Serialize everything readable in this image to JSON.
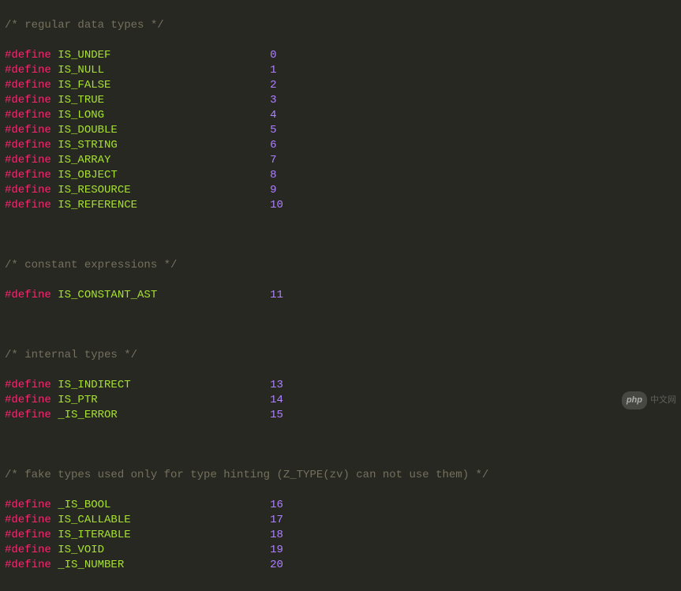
{
  "comment1": "/* regular data types */",
  "defines1": [
    {
      "keyword": "#define",
      "name": "IS_UNDEF",
      "value": "0"
    },
    {
      "keyword": "#define",
      "name": "IS_NULL",
      "value": "1"
    },
    {
      "keyword": "#define",
      "name": "IS_FALSE",
      "value": "2"
    },
    {
      "keyword": "#define",
      "name": "IS_TRUE",
      "value": "3"
    },
    {
      "keyword": "#define",
      "name": "IS_LONG",
      "value": "4"
    },
    {
      "keyword": "#define",
      "name": "IS_DOUBLE",
      "value": "5"
    },
    {
      "keyword": "#define",
      "name": "IS_STRING",
      "value": "6"
    },
    {
      "keyword": "#define",
      "name": "IS_ARRAY",
      "value": "7"
    },
    {
      "keyword": "#define",
      "name": "IS_OBJECT",
      "value": "8"
    },
    {
      "keyword": "#define",
      "name": "IS_RESOURCE",
      "value": "9"
    },
    {
      "keyword": "#define",
      "name": "IS_REFERENCE",
      "value": "10"
    }
  ],
  "comment2": "/* constant expressions */",
  "defines2": [
    {
      "keyword": "#define",
      "name": "IS_CONSTANT_AST",
      "value": "11"
    }
  ],
  "comment3": "/* internal types */",
  "defines3": [
    {
      "keyword": "#define",
      "name": "IS_INDIRECT",
      "value": "13"
    },
    {
      "keyword": "#define",
      "name": "IS_PTR",
      "value": "14"
    },
    {
      "keyword": "#define",
      "name": "_IS_ERROR",
      "value": "15"
    }
  ],
  "comment4": "/* fake types used only for type hinting (Z_TYPE(zv) can not use them) */",
  "defines4": [
    {
      "keyword": "#define",
      "name": "_IS_BOOL",
      "value": "16"
    },
    {
      "keyword": "#define",
      "name": "IS_CALLABLE",
      "value": "17"
    },
    {
      "keyword": "#define",
      "name": "IS_ITERABLE",
      "value": "18"
    },
    {
      "keyword": "#define",
      "name": "IS_VOID",
      "value": "19"
    },
    {
      "keyword": "#define",
      "name": "_IS_NUMBER",
      "value": "20"
    }
  ],
  "watermark": {
    "badge": "php",
    "text": "中文网"
  }
}
